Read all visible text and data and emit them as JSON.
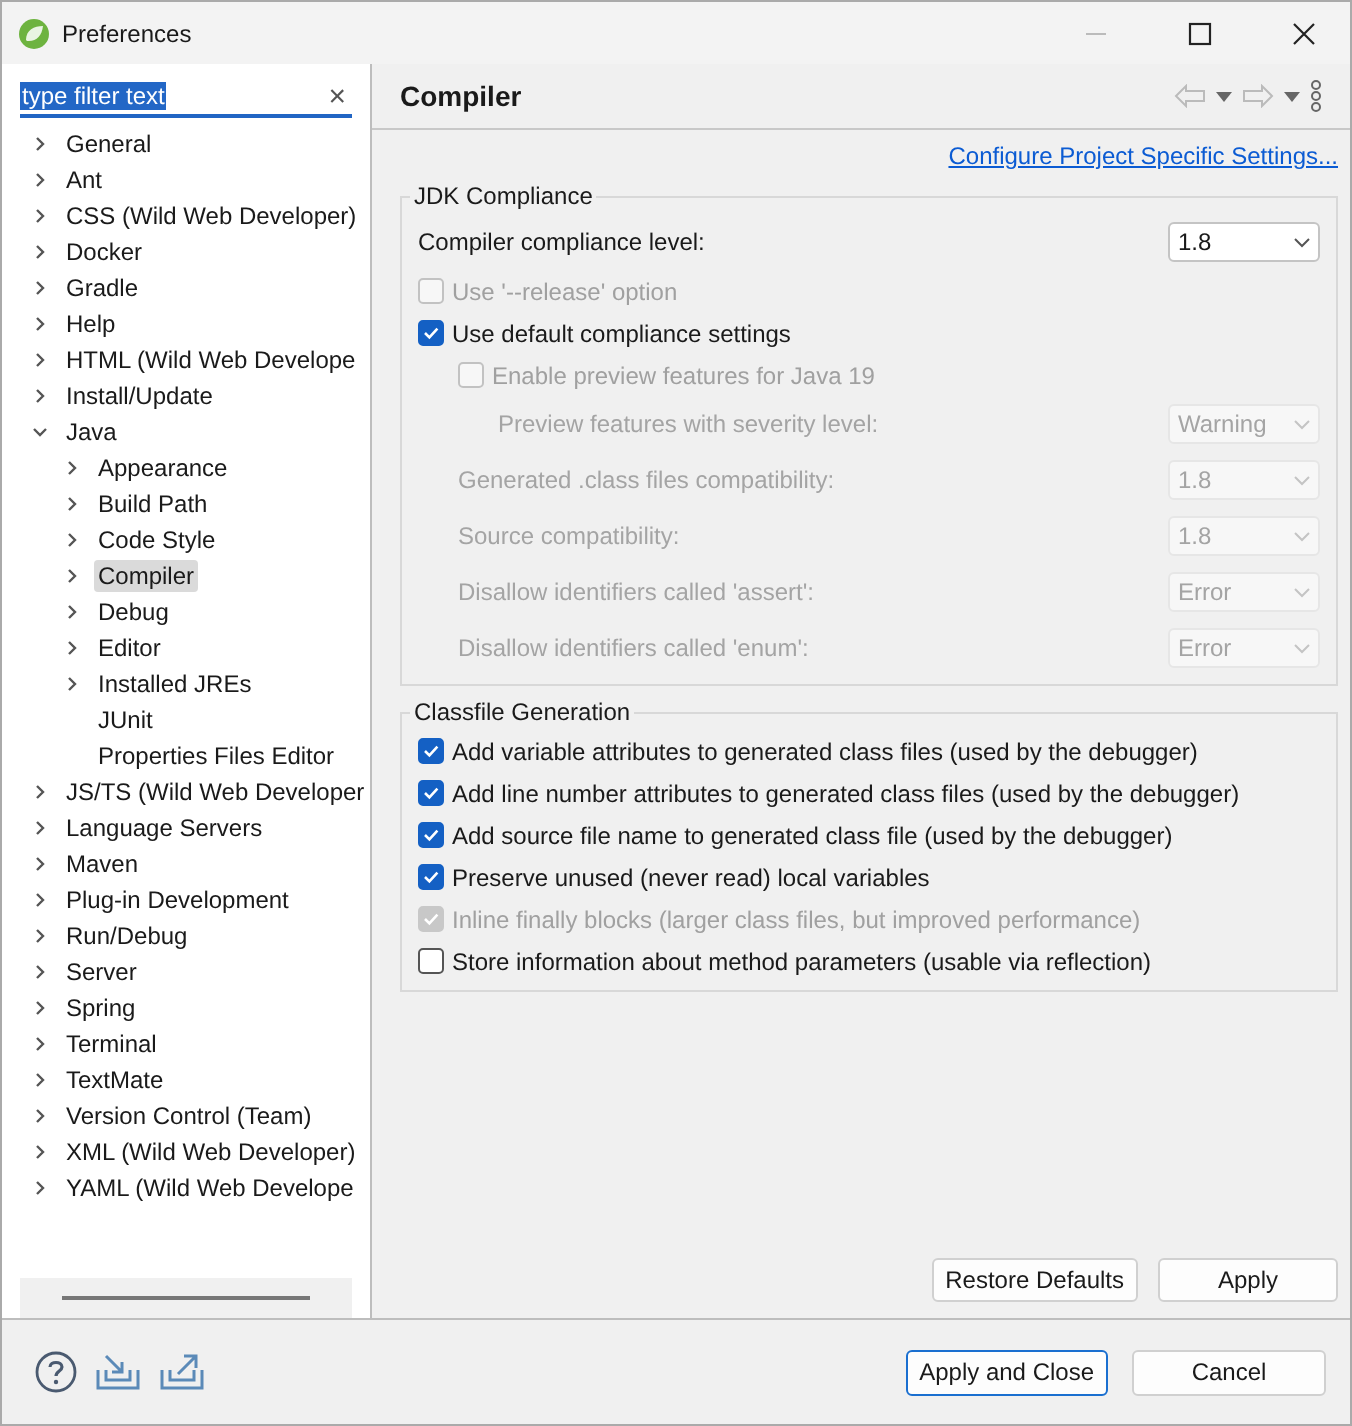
{
  "window": {
    "title": "Preferences"
  },
  "filter": {
    "value": "type filter text",
    "clear": "×"
  },
  "tree": [
    {
      "label": "General",
      "kind": "folder",
      "expanded": false,
      "selected": false
    },
    {
      "label": "Ant",
      "kind": "folder",
      "expanded": false,
      "selected": false
    },
    {
      "label": "CSS (Wild Web Developer)",
      "kind": "folder",
      "expanded": false,
      "selected": false
    },
    {
      "label": "Docker",
      "kind": "folder",
      "expanded": false,
      "selected": false
    },
    {
      "label": "Gradle",
      "kind": "folder",
      "expanded": false,
      "selected": false
    },
    {
      "label": "Help",
      "kind": "folder",
      "expanded": false,
      "selected": false
    },
    {
      "label": "HTML (Wild Web Develope",
      "kind": "folder",
      "expanded": false,
      "selected": false
    },
    {
      "label": "Install/Update",
      "kind": "folder",
      "expanded": false,
      "selected": false
    },
    {
      "label": "Java",
      "kind": "folder",
      "expanded": true,
      "selected": false,
      "children": [
        {
          "label": "Appearance",
          "kind": "folder",
          "expanded": false,
          "selected": false
        },
        {
          "label": "Build Path",
          "kind": "folder",
          "expanded": false,
          "selected": false
        },
        {
          "label": "Code Style",
          "kind": "folder",
          "expanded": false,
          "selected": false
        },
        {
          "label": "Compiler",
          "kind": "folder",
          "expanded": false,
          "selected": true
        },
        {
          "label": "Debug",
          "kind": "folder",
          "expanded": false,
          "selected": false
        },
        {
          "label": "Editor",
          "kind": "folder",
          "expanded": false,
          "selected": false
        },
        {
          "label": "Installed JREs",
          "kind": "folder",
          "expanded": false,
          "selected": false
        },
        {
          "label": "JUnit",
          "kind": "leaf",
          "selected": false
        },
        {
          "label": "Properties Files Editor",
          "kind": "leaf",
          "selected": false
        }
      ]
    },
    {
      "label": "JS/TS (Wild Web Developer",
      "kind": "folder",
      "expanded": false,
      "selected": false
    },
    {
      "label": "Language Servers",
      "kind": "folder",
      "expanded": false,
      "selected": false
    },
    {
      "label": "Maven",
      "kind": "folder",
      "expanded": false,
      "selected": false
    },
    {
      "label": "Plug-in Development",
      "kind": "folder",
      "expanded": false,
      "selected": false
    },
    {
      "label": "Run/Debug",
      "kind": "folder",
      "expanded": false,
      "selected": false
    },
    {
      "label": "Server",
      "kind": "folder",
      "expanded": false,
      "selected": false
    },
    {
      "label": "Spring",
      "kind": "folder",
      "expanded": false,
      "selected": false
    },
    {
      "label": "Terminal",
      "kind": "folder",
      "expanded": false,
      "selected": false
    },
    {
      "label": "TextMate",
      "kind": "folder",
      "expanded": false,
      "selected": false
    },
    {
      "label": "Version Control (Team)",
      "kind": "folder",
      "expanded": false,
      "selected": false
    },
    {
      "label": "XML (Wild Web Developer)",
      "kind": "folder",
      "expanded": false,
      "selected": false
    },
    {
      "label": "YAML (Wild Web Develope",
      "kind": "folder",
      "expanded": false,
      "selected": false
    }
  ],
  "page": {
    "title": "Compiler",
    "link": "Configure Project Specific Settings..."
  },
  "jdk": {
    "title": "JDK Compliance",
    "items": [
      {
        "kind": "select",
        "label": "Compiler compliance level:",
        "value": "1.8",
        "disabled": false
      },
      {
        "kind": "checkbox",
        "label": "Use '--release' option",
        "checked": false,
        "disabled": true
      },
      {
        "kind": "checkbox",
        "label": "Use default compliance settings",
        "checked": true,
        "disabled": false,
        "children": [
          {
            "kind": "checkbox",
            "label": "Enable preview features for Java 19",
            "checked": false,
            "disabled": true,
            "children": [
              {
                "kind": "select",
                "label": "Preview features with severity level:",
                "value": "Warning",
                "disabled": true
              }
            ]
          },
          {
            "kind": "select",
            "label": "Generated .class files compatibility:",
            "value": "1.8",
            "disabled": true
          },
          {
            "kind": "select",
            "label": "Source compatibility:",
            "value": "1.8",
            "disabled": true
          },
          {
            "kind": "select",
            "label": "Disallow identifiers called 'assert':",
            "value": "Error",
            "disabled": true
          },
          {
            "kind": "select",
            "label": "Disallow identifiers called 'enum':",
            "value": "Error",
            "disabled": true
          }
        ]
      }
    ]
  },
  "classfile": {
    "title": "Classfile Generation",
    "items": [
      {
        "kind": "checkbox",
        "label": "Add variable attributes to generated class files (used by the debugger)",
        "checked": true,
        "disabled": false
      },
      {
        "kind": "checkbox",
        "label": "Add line number attributes to generated class files (used by the debugger)",
        "checked": true,
        "disabled": false
      },
      {
        "kind": "checkbox",
        "label": "Add source file name to generated class file (used by the debugger)",
        "checked": true,
        "disabled": false
      },
      {
        "kind": "checkbox",
        "label": "Preserve unused (never read) local variables",
        "checked": true,
        "disabled": false
      },
      {
        "kind": "checkbox",
        "label": "Inline finally blocks (larger class files, but improved performance)",
        "checked": true,
        "disabled": true
      },
      {
        "kind": "checkbox",
        "label": "Store information about method parameters (usable via reflection)",
        "checked": false,
        "disabled": false
      }
    ]
  },
  "page_buttons": [
    "Restore Defaults",
    "Apply"
  ],
  "footer_buttons": [
    {
      "label": "Apply and Close",
      "default": true
    },
    {
      "label": "Cancel",
      "default": false
    }
  ]
}
